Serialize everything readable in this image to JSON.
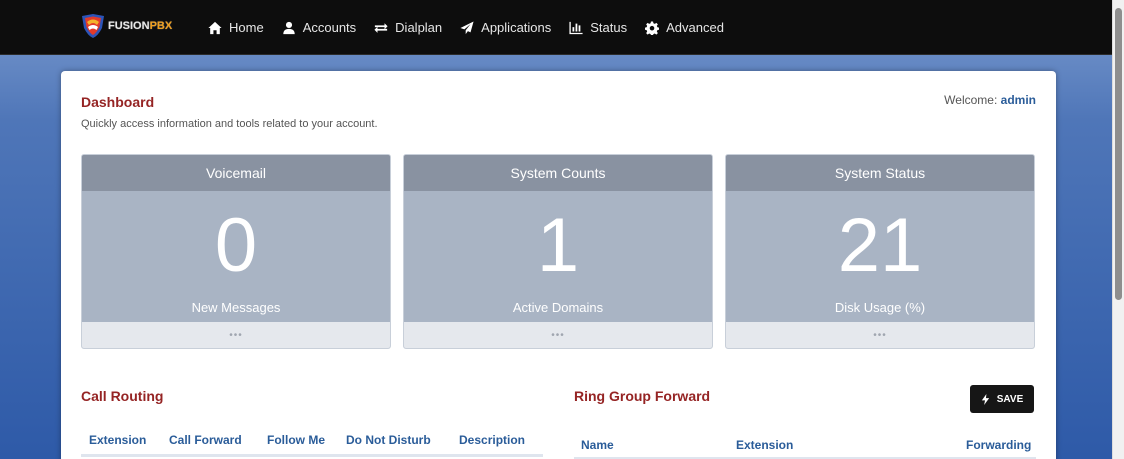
{
  "navbar": {
    "logo": {
      "text_a": "FUSION",
      "text_b": "PBX"
    },
    "items": [
      {
        "label": "Home",
        "icon": "home-icon"
      },
      {
        "label": "Accounts",
        "icon": "user-icon"
      },
      {
        "label": "Dialplan",
        "icon": "exchange-icon"
      },
      {
        "label": "Applications",
        "icon": "paper-plane-icon"
      },
      {
        "label": "Status",
        "icon": "bar-chart-icon"
      },
      {
        "label": "Advanced",
        "icon": "gear-icon"
      }
    ]
  },
  "dashboard": {
    "title": "Dashboard",
    "subtitle": "Quickly access information and tools related to your account.",
    "welcome_prefix": "Welcome:",
    "welcome_user": "admin"
  },
  "widgets": [
    {
      "title": "Voicemail",
      "value": "0",
      "label": "New Messages",
      "footer": "•••"
    },
    {
      "title": "System Counts",
      "value": "1",
      "label": "Active Domains",
      "footer": "•••"
    },
    {
      "title": "System Status",
      "value": "21",
      "label": "Disk Usage (%)",
      "footer": "•••"
    }
  ],
  "call_routing": {
    "title": "Call Routing",
    "columns": [
      "Extension",
      "Call Forward",
      "Follow Me",
      "Do Not Disturb",
      "Description"
    ]
  },
  "ring_group_forward": {
    "title": "Ring Group Forward",
    "save_label": "SAVE",
    "columns": [
      "Name",
      "Extension",
      "Forwarding"
    ]
  },
  "colors": {
    "navbar_bg": "#0d0d0d",
    "accent_red": "#952424",
    "link_blue": "#2a5c99",
    "widget_head": "#8992a1",
    "widget_body": "#a9b4c4"
  }
}
